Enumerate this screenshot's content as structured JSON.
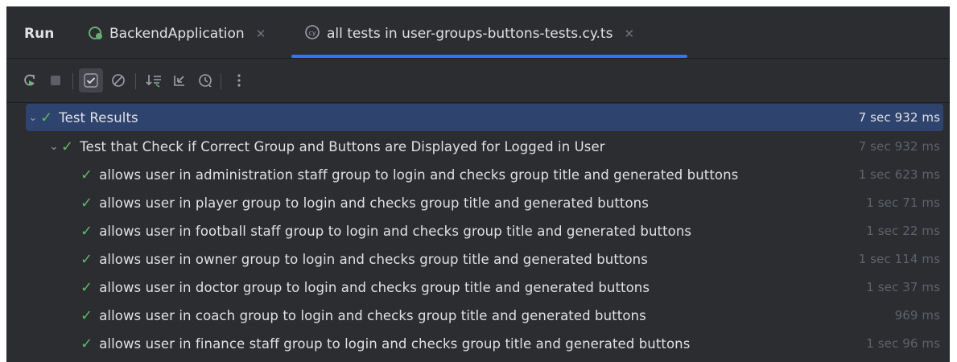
{
  "run": {
    "label": "Run"
  },
  "tabs": [
    {
      "label": "BackendApplication",
      "active": false
    },
    {
      "label": "all tests in user-groups-buttons-tests.cy.ts",
      "active": true
    }
  ],
  "toolbar": {
    "icons": [
      "rerun-icon",
      "stop-icon",
      "show-passed-icon",
      "show-ignored-icon",
      "sort-icon",
      "collapse-icon",
      "history-icon",
      "more-icon"
    ]
  },
  "tree": {
    "root": {
      "label": "Test Results",
      "time": "7 sec 932 ms"
    },
    "suite": {
      "label": "Test that Check if Correct Group and Buttons are Displayed for Logged in User",
      "time": "7 sec 932 ms"
    },
    "tests": [
      {
        "label": "allows user in administration staff group to login and checks group title and generated buttons",
        "time": "1 sec 623 ms"
      },
      {
        "label": "allows user in player group to login and checks group title and generated buttons",
        "time": "1 sec 71 ms"
      },
      {
        "label": "allows user in football staff group to login and checks group title and generated buttons",
        "time": "1 sec 22 ms"
      },
      {
        "label": "allows user in owner group to login and checks group title and generated buttons",
        "time": "1 sec 114 ms"
      },
      {
        "label": "allows user in doctor group to login and checks group title and generated buttons",
        "time": "1 sec 37 ms"
      },
      {
        "label": "allows user in coach group to login and checks group title and generated buttons",
        "time": "969 ms"
      },
      {
        "label": "allows user in finance staff group to login and checks group title and generated buttons",
        "time": "1 sec 96 ms"
      }
    ]
  },
  "colors": {
    "pass": "#5fb865",
    "selection": "#2e436e",
    "accent": "#3574f0",
    "background": "#2b2d30"
  }
}
